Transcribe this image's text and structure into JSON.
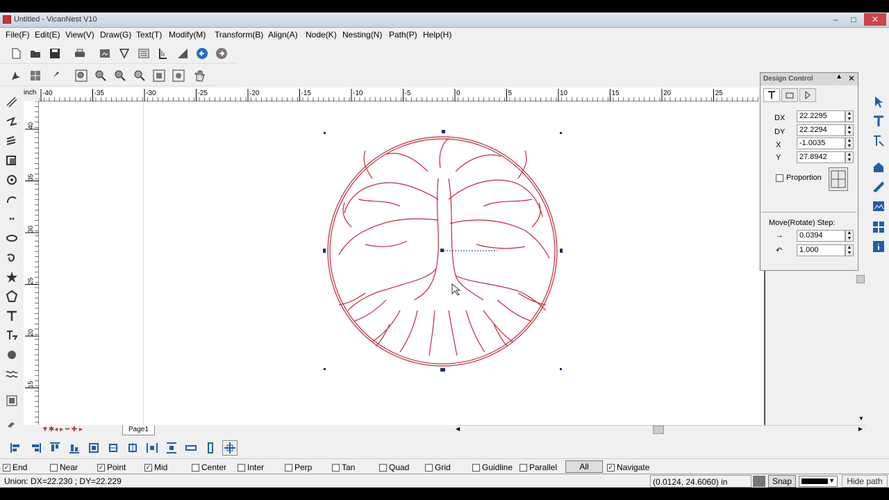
{
  "window": {
    "title": "Untitled - VicanNest V10",
    "min": "–",
    "max": "□",
    "close": "✕"
  },
  "menu": [
    "File(F)",
    "Edit(E)",
    "View(V)",
    "Draw(G)",
    "Text(T)",
    "Modify(M)",
    "Transform(B)",
    "Align(A)",
    "Node(K)",
    "Nesting(N)",
    "Path(P)",
    "Help(H)"
  ],
  "ruler": {
    "unit": "inch",
    "top_ticks": [
      "-40",
      "-35",
      "-30",
      "-25",
      "-20",
      "-15",
      "-10",
      "-5",
      "0",
      "5",
      "10",
      "15",
      "20",
      "25"
    ],
    "left_ticks": [
      "40",
      "35",
      "30",
      "25",
      "20",
      "15"
    ]
  },
  "page_tab": "Page1",
  "design_panel": {
    "title": "Design Control",
    "dx_label": "DX",
    "dx": "22.2295",
    "dy_label": "DY",
    "dy": "22.2294",
    "x_label": "X",
    "x": "-1.0035",
    "y_label": "Y",
    "y": "27.8942",
    "proportion": "Proportion",
    "step_title": "Move(Rotate) Step:",
    "move_step": "0.0394",
    "rotate_step": "1.000"
  },
  "snap": {
    "items": [
      {
        "label": "End",
        "checked": true
      },
      {
        "label": "Near",
        "checked": false
      },
      {
        "label": "Point",
        "checked": true
      },
      {
        "label": "Mid",
        "checked": true
      },
      {
        "label": "Center",
        "checked": false
      },
      {
        "label": "Inter",
        "checked": false
      },
      {
        "label": "Perp",
        "checked": false
      },
      {
        "label": "Tan",
        "checked": false
      },
      {
        "label": "Quad",
        "checked": false
      },
      {
        "label": "Grid",
        "checked": false
      },
      {
        "label": "Guidline",
        "checked": false
      },
      {
        "label": "Parallel",
        "checked": false
      }
    ],
    "all_label": "All",
    "navigate_label": "Navigate",
    "navigate_checked": true
  },
  "status": {
    "left": "Union: DX=22.230 ; DY=22.229",
    "coords": "(0.0124, 24.6060) in",
    "snap_button": "Snap",
    "hide_path": "Hide path"
  },
  "colors": {
    "design_stroke": "#c0283a",
    "selection": "#1a2a7a"
  }
}
